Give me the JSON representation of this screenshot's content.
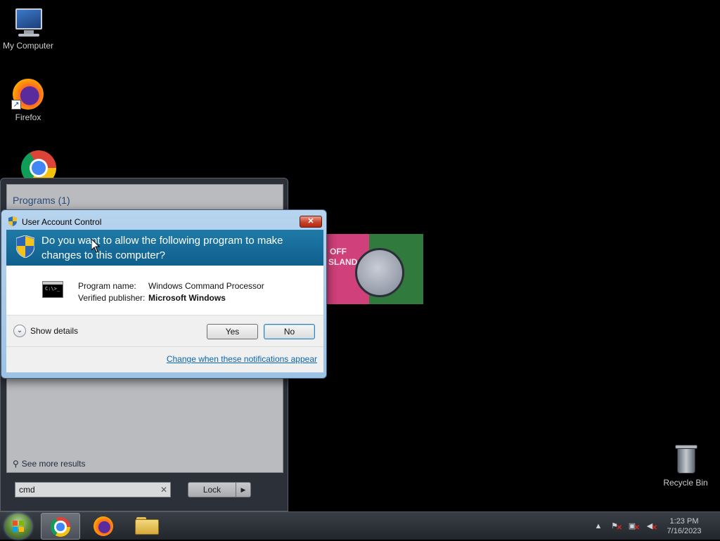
{
  "desktop": {
    "icons": [
      {
        "label": "My Computer"
      },
      {
        "label": "Firefox"
      },
      {
        "label": ""
      },
      {
        "label": "Recycle Bin"
      }
    ],
    "thumbnail": {
      "text_left": "OFF",
      "text_left2": "SLAND"
    }
  },
  "start_menu": {
    "programs_header": "Programs (1)",
    "see_more": "See more results",
    "search_value": "cmd",
    "search_clear": "✕",
    "lock_button": "Lock",
    "lock_arrow": "▶"
  },
  "uac": {
    "title": "User Account Control",
    "close": "✕",
    "question": "Do you want to allow the following program to make changes to this computer?",
    "program_name_label": "Program name:",
    "program_name_value": "Windows Command Processor",
    "publisher_label": "Verified publisher:",
    "publisher_value": "Microsoft Windows",
    "show_details": "Show details",
    "yes": "Yes",
    "no": "No",
    "change_link": "Change when these notifications appear",
    "cmd_icon_text": "C:\\>_"
  },
  "taskbar": {
    "items": [
      "chrome",
      "firefox",
      "explorer"
    ],
    "active_item": "chrome",
    "clock_time": "1:23 PM",
    "clock_date": "7/16/2023",
    "tray_arrow": "▲"
  },
  "colors": {
    "banner": "#1f7aa8",
    "link": "#0a66b0",
    "close_red": "#c8432a"
  }
}
